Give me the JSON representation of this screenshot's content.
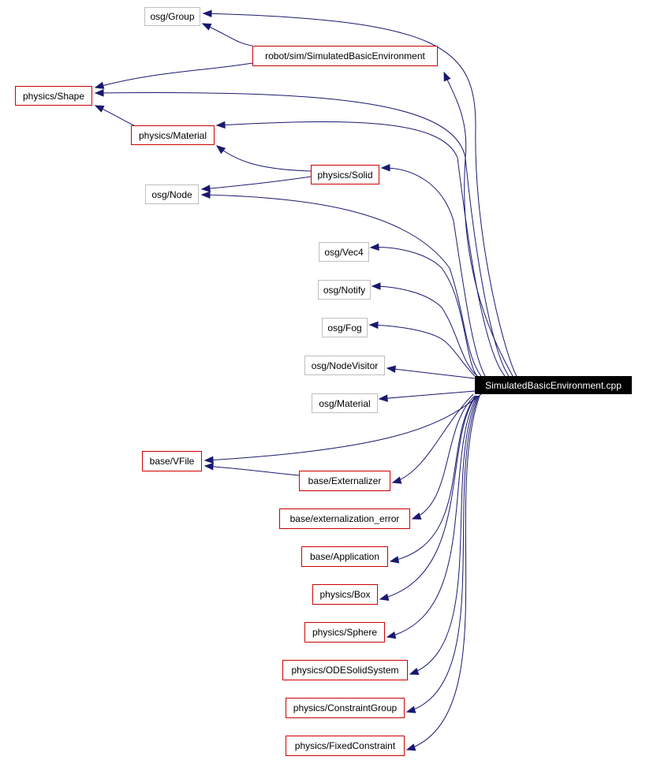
{
  "diagram": {
    "type": "include-dependency-graph",
    "root": {
      "id": "root",
      "label": "SimulatedBasicEnvironment.cpp"
    },
    "colors": {
      "edge": "#191970",
      "documented_border": "#cc0000",
      "external_border": "#bfbfbf",
      "root_fill": "#000000",
      "root_text": "#ffffff"
    },
    "nodes": [
      {
        "id": "osg-group",
        "label": "osg/Group",
        "kind": "external"
      },
      {
        "id": "robot-sim-simulatedbasicenvironment",
        "label": "robot/sim/SimulatedBasicEnvironment",
        "kind": "documented"
      },
      {
        "id": "physics-shape",
        "label": "physics/Shape",
        "kind": "documented"
      },
      {
        "id": "physics-material",
        "label": "physics/Material",
        "kind": "documented"
      },
      {
        "id": "physics-solid",
        "label": "physics/Solid",
        "kind": "documented"
      },
      {
        "id": "osg-node",
        "label": "osg/Node",
        "kind": "external"
      },
      {
        "id": "osg-vec4",
        "label": "osg/Vec4",
        "kind": "external"
      },
      {
        "id": "osg-notify",
        "label": "osg/Notify",
        "kind": "external"
      },
      {
        "id": "osg-fog",
        "label": "osg/Fog",
        "kind": "external"
      },
      {
        "id": "osg-nodevisitor",
        "label": "osg/NodeVisitor",
        "kind": "external"
      },
      {
        "id": "osg-material",
        "label": "osg/Material",
        "kind": "external"
      },
      {
        "id": "base-vfile",
        "label": "base/VFile",
        "kind": "documented"
      },
      {
        "id": "base-externalizer",
        "label": "base/Externalizer",
        "kind": "documented"
      },
      {
        "id": "base-externalization-error",
        "label": "base/externalization_error",
        "kind": "documented"
      },
      {
        "id": "base-application",
        "label": "base/Application",
        "kind": "documented"
      },
      {
        "id": "physics-box",
        "label": "physics/Box",
        "kind": "documented"
      },
      {
        "id": "physics-sphere",
        "label": "physics/Sphere",
        "kind": "documented"
      },
      {
        "id": "physics-odesolidsystem",
        "label": "physics/ODESolidSystem",
        "kind": "documented"
      },
      {
        "id": "physics-constraintgroup",
        "label": "physics/ConstraintGroup",
        "kind": "documented"
      },
      {
        "id": "physics-fixedconstraint",
        "label": "physics/FixedConstraint",
        "kind": "documented"
      }
    ],
    "edges": [
      {
        "from": "root",
        "to": "osg-group"
      },
      {
        "from": "root",
        "to": "robot-sim-simulatedbasicenvironment"
      },
      {
        "from": "root",
        "to": "physics-shape"
      },
      {
        "from": "root",
        "to": "physics-material"
      },
      {
        "from": "root",
        "to": "physics-solid"
      },
      {
        "from": "root",
        "to": "osg-node"
      },
      {
        "from": "root",
        "to": "osg-vec4"
      },
      {
        "from": "root",
        "to": "osg-notify"
      },
      {
        "from": "root",
        "to": "osg-fog"
      },
      {
        "from": "root",
        "to": "osg-nodevisitor"
      },
      {
        "from": "root",
        "to": "osg-material"
      },
      {
        "from": "root",
        "to": "base-vfile"
      },
      {
        "from": "root",
        "to": "base-externalizer"
      },
      {
        "from": "root",
        "to": "base-externalization-error"
      },
      {
        "from": "root",
        "to": "base-application"
      },
      {
        "from": "root",
        "to": "physics-box"
      },
      {
        "from": "root",
        "to": "physics-sphere"
      },
      {
        "from": "root",
        "to": "physics-odesolidsystem"
      },
      {
        "from": "root",
        "to": "physics-constraintgroup"
      },
      {
        "from": "root",
        "to": "physics-fixedconstraint"
      },
      {
        "from": "robot-sim-simulatedbasicenvironment",
        "to": "osg-group"
      },
      {
        "from": "robot-sim-simulatedbasicenvironment",
        "to": "physics-shape"
      },
      {
        "from": "physics-material",
        "to": "physics-shape"
      },
      {
        "from": "physics-solid",
        "to": "physics-material"
      },
      {
        "from": "physics-solid",
        "to": "osg-node"
      },
      {
        "from": "base-externalizer",
        "to": "base-vfile"
      }
    ]
  }
}
